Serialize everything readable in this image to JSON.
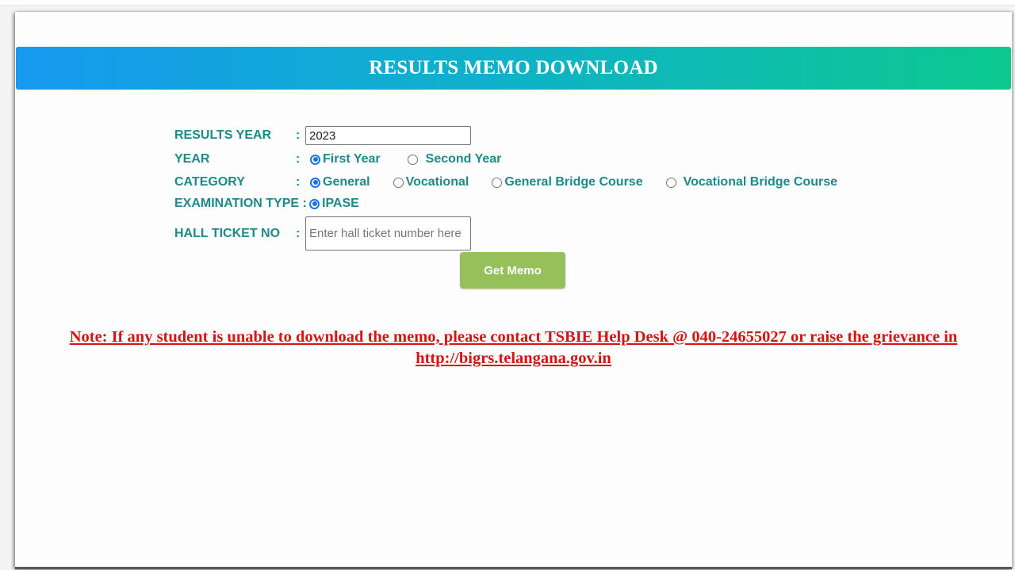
{
  "header": {
    "title": "RESULTS MEMO DOWNLOAD"
  },
  "form": {
    "results_year": {
      "label": "RESULTS YEAR",
      "colon": ":",
      "value": "2023"
    },
    "year": {
      "label": "YEAR",
      "colon": ":",
      "options": [
        {
          "label": "First Year",
          "checked": true
        },
        {
          "label": "Second Year",
          "checked": false
        }
      ]
    },
    "category": {
      "label": "CATEGORY",
      "colon": ":",
      "options": [
        {
          "label": "General",
          "checked": true
        },
        {
          "label": "Vocational",
          "checked": false
        },
        {
          "label": "General Bridge Course",
          "checked": false
        },
        {
          "label": "Vocational Bridge Course",
          "checked": false
        }
      ]
    },
    "exam_type": {
      "label": "EXAMINATION TYPE :",
      "colon": "",
      "options": [
        {
          "label": "IPASE",
          "checked": true
        }
      ]
    },
    "hall_ticket": {
      "label": "HALL TICKET NO",
      "colon": ":",
      "value": "",
      "placeholder": "Enter hall ticket number here"
    },
    "submit_label": "Get Memo"
  },
  "note": {
    "text": "Note: If any student is unable to download the memo, please contact TSBIE Help Desk @ 040-24655027 or raise the grievance in",
    "link": "http://bigrs.telangana.gov.in"
  },
  "colors": {
    "label": "#1d8a8a",
    "note": "#d41414",
    "button": "#95c05a",
    "header_start": "#169af0",
    "header_end": "#0cc98f"
  }
}
